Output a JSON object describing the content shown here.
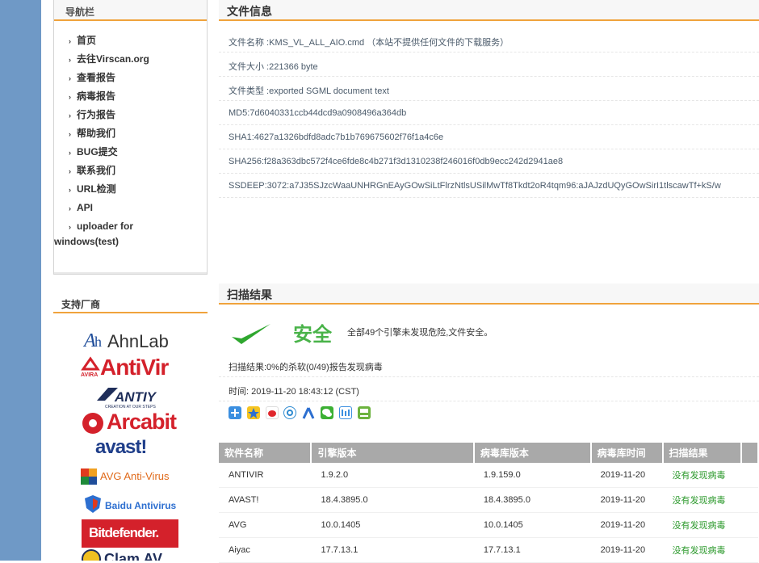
{
  "sidebar": {
    "nav_title": "导航栏",
    "nav_items": [
      "首页",
      "去往Virscan.org",
      "查看报告",
      "病毒报告",
      "行为报告",
      "帮助我们",
      "BUG提交",
      "联系我们",
      "URL检测",
      "API"
    ],
    "nav_multi": [
      "uploader for",
      "windows(test)"
    ],
    "vendor_title": "支持厂商",
    "vendors": [
      "AhnLab",
      "AntiVir",
      "ANTIY",
      "Arcabit",
      "avast!",
      "AVG Anti-Virus",
      "Baidu Antivirus",
      "Bitdefender.",
      "Clam AV"
    ],
    "vendor_sub": {
      "avira": "AVIRA",
      "antiy": "CREATION AT OUR STEPS"
    }
  },
  "file_info": {
    "title": "文件信息",
    "rows": [
      "文件名称 :KMS_VL_ALL_AIO.cmd  （本站不提供任何文件的下载服务）",
      "文件大小 :221366 byte",
      "文件类型 :exported SGML document text",
      "MD5:7d6040331ccb44dcd9a0908496a364db",
      "SHA1:4627a1326bdfd8adc7b1b769675602f76f1a4c6e",
      "SHA256:f28a363dbc572f4ce6fde8c4b271f3d1310238f246016f0db9ecc242d2941ae8",
      "SSDEEP:3072:a7J35SJzcWaaUNHRGnEAyGOwSiLtFlrzNtlsUSilMwTf8Tkdt2oR4tqm96:aJAJzdUQyGOwSirI1tlscawTf+kS/w"
    ]
  },
  "scan": {
    "title": "扫描结果",
    "status": "安全",
    "status_desc": "全部49个引擎未发现危险,文件安全。",
    "summary": "扫描结果:0%的杀软(0/49)报告发现病毒",
    "time": "时间: 2019-11-20 18:43:12 (CST)",
    "share_icons": [
      "share-plus-icon",
      "qzone-icon",
      "weibo-icon",
      "tencent-weibo-icon",
      "renren-icon",
      "wechat-icon",
      "tieba-icon",
      "douban-icon"
    ],
    "columns": [
      "软件名称",
      "引擎版本",
      "病毒库版本",
      "病毒库时间",
      "扫描结果"
    ],
    "rows": [
      [
        "ANTIVIR",
        "1.9.2.0",
        "1.9.159.0",
        "2019-11-20",
        "没有发现病毒"
      ],
      [
        "AVAST!",
        "18.4.3895.0",
        "18.4.3895.0",
        "2019-11-20",
        "没有发现病毒"
      ],
      [
        "AVG",
        "10.0.1405",
        "10.0.1405",
        "2019-11-20",
        "没有发现病毒"
      ],
      [
        "Aiyac",
        "17.7.13.1",
        "17.7.13.1",
        "2019-11-20",
        "没有发现病毒"
      ]
    ]
  },
  "colors": {
    "accent": "#f0a33c",
    "safe": "#49b349",
    "left_bar": "#6f99c6",
    "table_head": "#a9a9a9"
  }
}
